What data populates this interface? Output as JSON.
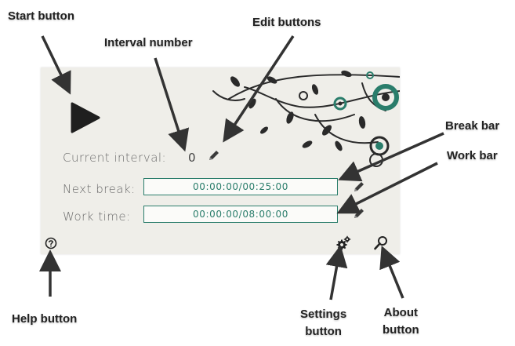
{
  "callouts": {
    "start": "Start button",
    "edit": "Edit buttons",
    "interval": "Interval number",
    "break_bar": "Break bar",
    "work_bar": "Work bar",
    "help": "Help button",
    "settings": [
      "Settings",
      "button"
    ],
    "about": [
      "About",
      "button"
    ]
  },
  "timer": {
    "current_interval_label": "Current interval:",
    "current_interval_value": "0",
    "next_break_label": "Next break:",
    "next_break_elapsed": "00:00:00",
    "next_break_total": "/00:25:00",
    "next_break_progress": 0,
    "work_time_label": "Work time:",
    "work_time_elapsed": "00:00:00",
    "work_time_total": "/08:00:00",
    "work_time_progress": 0
  },
  "icons": {
    "play": "play-icon",
    "edit": "pencil-icon",
    "help": "question-circle-icon",
    "settings": "gears-icon",
    "about": "magnifier-icon"
  },
  "colors": {
    "accent": "#2a7d6b",
    "panel_bg": "#efeee9",
    "text": "#6b6b6b"
  }
}
